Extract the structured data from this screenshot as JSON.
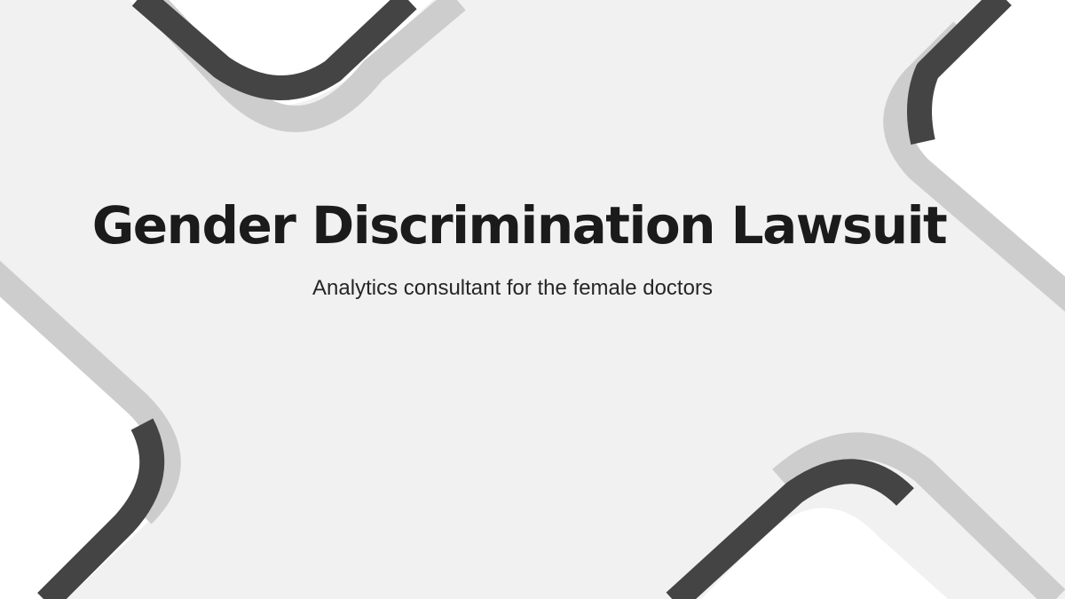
{
  "slide": {
    "title": "Gender Discrimination Lawsuit",
    "subtitle": "Analytics consultant for the female doctors"
  },
  "colors": {
    "page_background": "#ffffff",
    "x_shape_fill": "#f1f1f1",
    "dark_edge": "#444444",
    "light_edge": "#cdcdcd",
    "title_text": "#1b1b1b",
    "subtitle_text": "#262626"
  }
}
